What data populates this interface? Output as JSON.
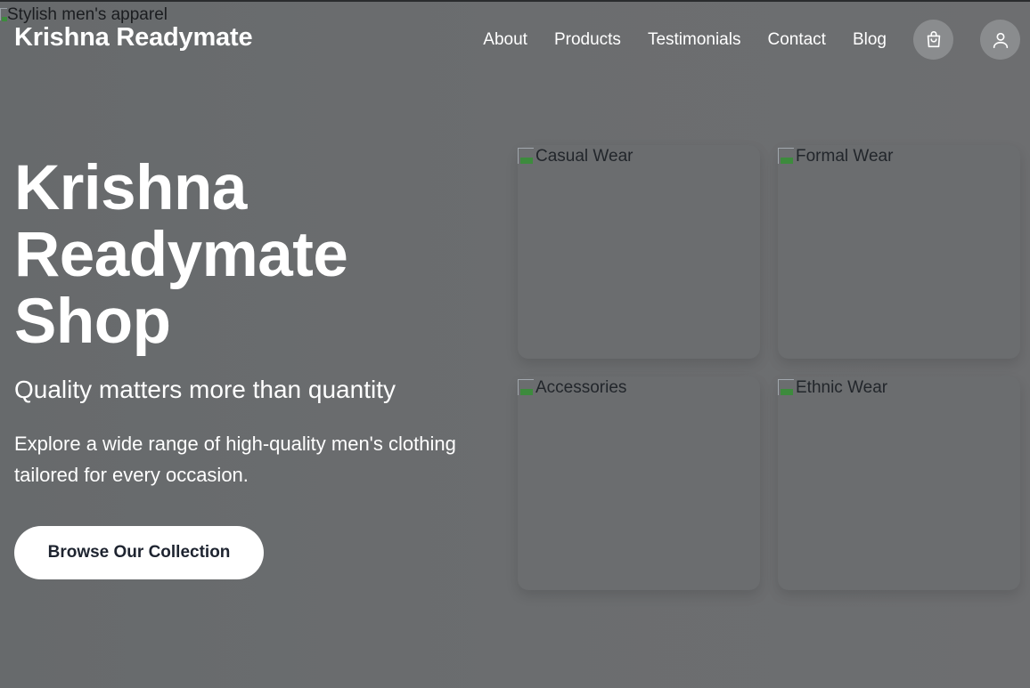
{
  "header": {
    "background_alt": "Stylish men's apparel",
    "brand": "Krishna Readymate",
    "nav": [
      {
        "label": "About"
      },
      {
        "label": "Products"
      },
      {
        "label": "Testimonials"
      },
      {
        "label": "Contact"
      },
      {
        "label": "Blog"
      }
    ],
    "icons": {
      "cart": "shopping-bag-icon",
      "user": "user-icon"
    }
  },
  "hero": {
    "title": "Krishna Readymate Shop",
    "subtitle": "Quality matters more than quantity",
    "description": "Explore a wide range of high-quality men's clothing tailored for every occasion.",
    "cta_label": "Browse Our Collection"
  },
  "categories": [
    {
      "alt": "Casual Wear"
    },
    {
      "alt": "Formal Wear"
    },
    {
      "alt": "Accessories"
    },
    {
      "alt": "Ethnic Wear"
    }
  ],
  "colors": {
    "overlay": "#6b6d6f",
    "text": "#ffffff",
    "button_bg": "#ffffff",
    "button_text": "#1e2430"
  }
}
